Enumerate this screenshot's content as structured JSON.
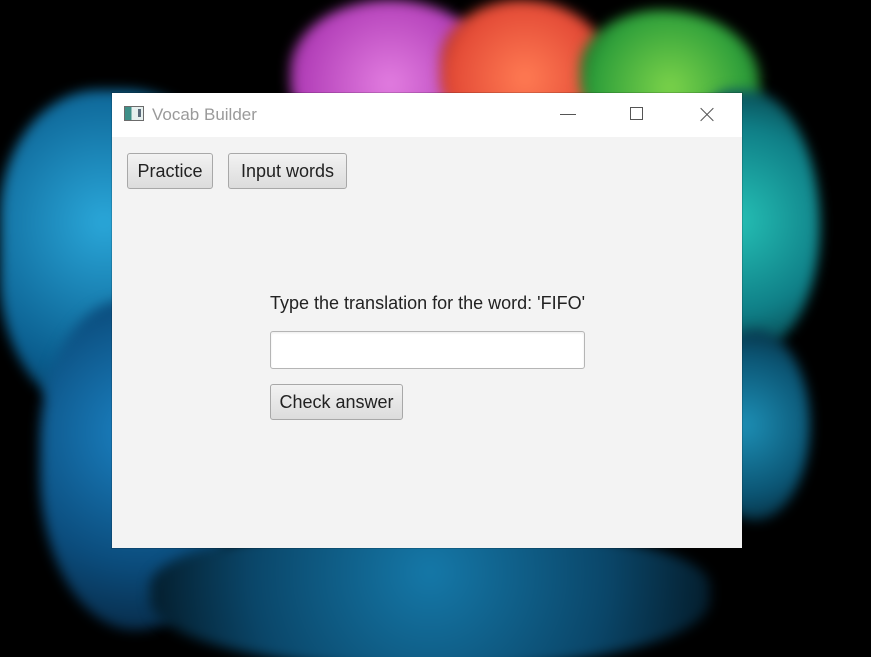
{
  "window": {
    "title": "Vocab Builder",
    "icon": "app-window-icon",
    "controls": {
      "minimize": "minimize-icon",
      "maximize": "maximize-icon",
      "close": "close-icon"
    }
  },
  "toolbar": {
    "practice_label": "Practice",
    "input_words_label": "Input words"
  },
  "practice": {
    "prompt": "Type the translation for the word: 'FIFO'",
    "answer_value": "",
    "answer_placeholder": "",
    "check_label": "Check answer"
  },
  "colors": {
    "window_background": "#f3f3f3",
    "titlebar_background": "#ffffff",
    "desktop_background": "#000000"
  }
}
